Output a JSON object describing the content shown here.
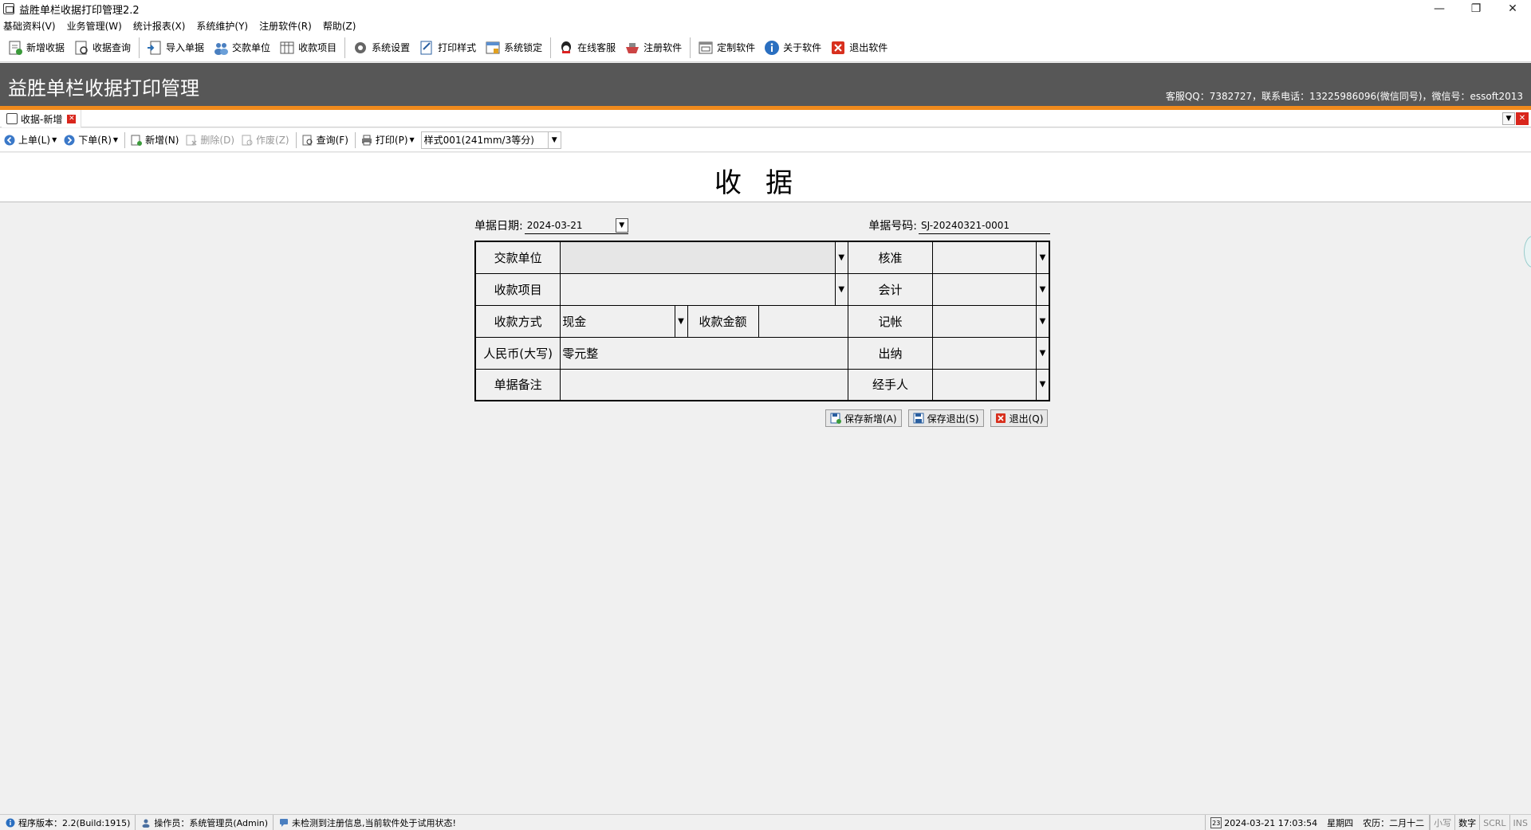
{
  "window": {
    "title": "益胜单栏收据打印管理2.2",
    "controls": [
      "—",
      "❐",
      "✕"
    ]
  },
  "menu": [
    "基础资料(V)",
    "业务管理(W)",
    "统计报表(X)",
    "系统维护(Y)",
    "注册软件(R)",
    "帮助(Z)"
  ],
  "toolbar": [
    {
      "label": "新增收据",
      "icon": "new-receipt-icon"
    },
    {
      "label": "收据查询",
      "icon": "receipt-query-icon"
    },
    {
      "label": "导入单据",
      "icon": "import-icon"
    },
    {
      "label": "交款单位",
      "icon": "payer-icon"
    },
    {
      "label": "收款项目",
      "icon": "items-icon"
    },
    {
      "label": "系统设置",
      "icon": "gear-icon"
    },
    {
      "label": "打印样式",
      "icon": "print-style-icon"
    },
    {
      "label": "系统锁定",
      "icon": "lock-icon"
    },
    {
      "label": "在线客服",
      "icon": "qq-icon"
    },
    {
      "label": "注册软件",
      "icon": "register-icon"
    },
    {
      "label": "定制软件",
      "icon": "custom-icon"
    },
    {
      "label": "关于软件",
      "icon": "info-icon"
    },
    {
      "label": "退出软件",
      "icon": "exit-icon"
    }
  ],
  "banner": {
    "title": "益胜单栏收据打印管理",
    "contact": "客服QQ：7382727，联系电话：13225986096(微信同号)，微信号：essoft2013"
  },
  "tab": {
    "label": "收据-新增"
  },
  "formbar": {
    "prev": "上单(L)",
    "next": "下单(R)",
    "add": "新增(N)",
    "delete": "删除(D)",
    "void": "作废(Z)",
    "query": "查询(F)",
    "print": "打印(P)",
    "style": "样式001(241mm/3等分)"
  },
  "receipt": {
    "title": "收据",
    "date_label": "单据日期:",
    "date_value": "2024-03-21",
    "no_label": "单据号码:",
    "no_value": "SJ-20240321-0001",
    "payer_label": "交款单位",
    "payer_value": "",
    "approve_label": "核准",
    "item_label": "收款项目",
    "accountant_label": "会计",
    "method_label": "收款方式",
    "method_value": "现金",
    "amount_label": "收款金额",
    "amount_value": "",
    "bookkeeper_label": "记帐",
    "rmb_label": "人民币(大写)",
    "rmb_value": "零元整",
    "cashier_label": "出纳",
    "remark_label": "单据备注",
    "handler_label": "经手人"
  },
  "actions": {
    "save_new": "保存新增(A)",
    "save_exit": "保存退出(S)",
    "exit": "退出(Q)"
  },
  "status": {
    "version": "程序版本：2.2(Build:1915)",
    "operator": "操作员：系统管理员(Admin)",
    "notice": "未检测到注册信息,当前软件处于试用状态!",
    "calendar_day": "23",
    "datetime": "2024-03-21 17:03:54",
    "weekday": "星期四",
    "lunar": "农历：二月十二",
    "keys": [
      "小写",
      "数字",
      "SCRL",
      "INS"
    ]
  }
}
